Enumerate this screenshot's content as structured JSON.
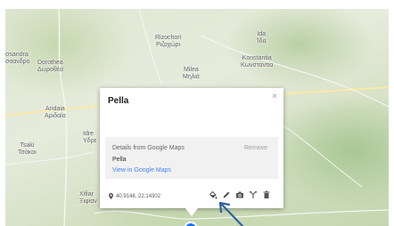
{
  "map": {
    "places": [
      {
        "id": "sandra",
        "line1": "σsandra",
        "line2": "σοανδρο"
      },
      {
        "id": "dorothea",
        "line1": "Dorothea",
        "line2": "Δωροθέα"
      },
      {
        "id": "rizochori",
        "line1": "Rizochori",
        "line2": "Ριζοχώρι"
      },
      {
        "id": "ida",
        "line1": "Ida",
        "line2": "Ίδα"
      },
      {
        "id": "konstantia",
        "line1": "Konstantia",
        "line2": "Κωνσταντία"
      },
      {
        "id": "milea",
        "line1": "Milea",
        "line2": "Μηλιά"
      },
      {
        "id": "aridaia",
        "line1": "Aridaia",
        "line2": "Αριδαία"
      },
      {
        "id": "idr",
        "line1": "Idre",
        "line2": "Υδρε"
      },
      {
        "id": "tsaki",
        "line1": "Tsaki",
        "line2": "Τσάκοι"
      },
      {
        "id": "xifian",
        "line1": "Xifiar",
        "line2": "Ξιφιαν"
      }
    ]
  },
  "popup": {
    "title": "Pella",
    "close_glyph": "×",
    "details": {
      "heading": "Details from Google Maps",
      "remove_label": "Remove",
      "value": "Pella",
      "link_label": "View in Google Maps"
    },
    "coordinates": "40.9148, 22.14302",
    "tools": [
      "paint-bucket-icon",
      "pencil-icon",
      "camera-icon",
      "directions-icon",
      "trash-icon"
    ]
  },
  "colors": {
    "marker": "#1a73e8",
    "arrow": "#2f5f9e",
    "link": "#4285f4"
  }
}
